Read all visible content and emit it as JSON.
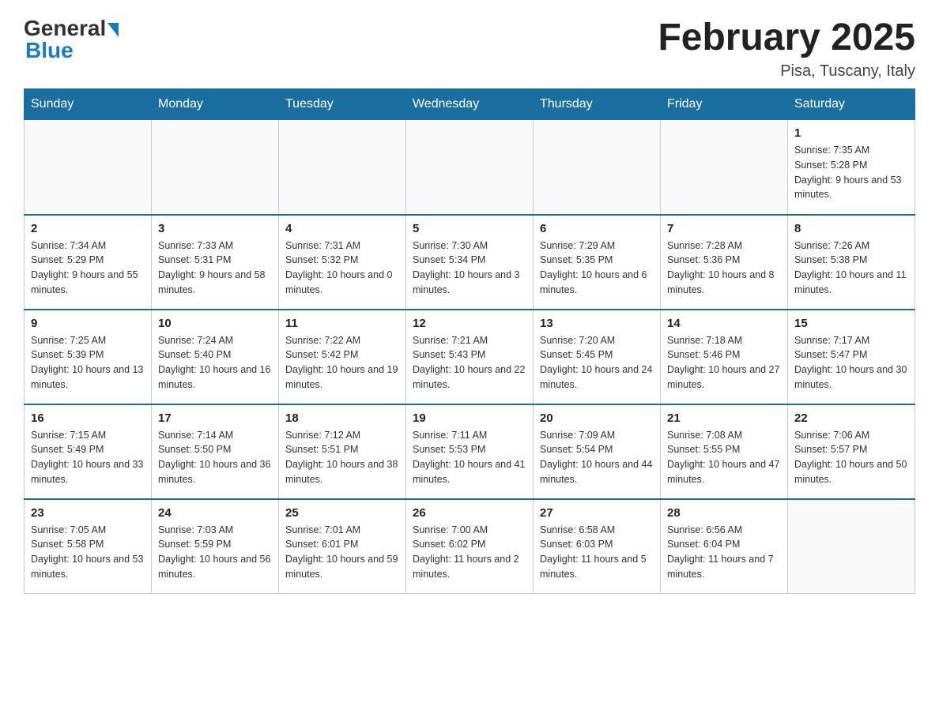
{
  "header": {
    "logo_general": "General",
    "logo_blue": "Blue",
    "month_title": "February 2025",
    "location": "Pisa, Tuscany, Italy"
  },
  "days_of_week": [
    "Sunday",
    "Monday",
    "Tuesday",
    "Wednesday",
    "Thursday",
    "Friday",
    "Saturday"
  ],
  "weeks": [
    {
      "days": [
        {
          "date": "",
          "info": ""
        },
        {
          "date": "",
          "info": ""
        },
        {
          "date": "",
          "info": ""
        },
        {
          "date": "",
          "info": ""
        },
        {
          "date": "",
          "info": ""
        },
        {
          "date": "",
          "info": ""
        },
        {
          "date": "1",
          "info": "Sunrise: 7:35 AM\nSunset: 5:28 PM\nDaylight: 9 hours and 53 minutes."
        }
      ]
    },
    {
      "days": [
        {
          "date": "2",
          "info": "Sunrise: 7:34 AM\nSunset: 5:29 PM\nDaylight: 9 hours and 55 minutes."
        },
        {
          "date": "3",
          "info": "Sunrise: 7:33 AM\nSunset: 5:31 PM\nDaylight: 9 hours and 58 minutes."
        },
        {
          "date": "4",
          "info": "Sunrise: 7:31 AM\nSunset: 5:32 PM\nDaylight: 10 hours and 0 minutes."
        },
        {
          "date": "5",
          "info": "Sunrise: 7:30 AM\nSunset: 5:34 PM\nDaylight: 10 hours and 3 minutes."
        },
        {
          "date": "6",
          "info": "Sunrise: 7:29 AM\nSunset: 5:35 PM\nDaylight: 10 hours and 6 minutes."
        },
        {
          "date": "7",
          "info": "Sunrise: 7:28 AM\nSunset: 5:36 PM\nDaylight: 10 hours and 8 minutes."
        },
        {
          "date": "8",
          "info": "Sunrise: 7:26 AM\nSunset: 5:38 PM\nDaylight: 10 hours and 11 minutes."
        }
      ]
    },
    {
      "days": [
        {
          "date": "9",
          "info": "Sunrise: 7:25 AM\nSunset: 5:39 PM\nDaylight: 10 hours and 13 minutes."
        },
        {
          "date": "10",
          "info": "Sunrise: 7:24 AM\nSunset: 5:40 PM\nDaylight: 10 hours and 16 minutes."
        },
        {
          "date": "11",
          "info": "Sunrise: 7:22 AM\nSunset: 5:42 PM\nDaylight: 10 hours and 19 minutes."
        },
        {
          "date": "12",
          "info": "Sunrise: 7:21 AM\nSunset: 5:43 PM\nDaylight: 10 hours and 22 minutes."
        },
        {
          "date": "13",
          "info": "Sunrise: 7:20 AM\nSunset: 5:45 PM\nDaylight: 10 hours and 24 minutes."
        },
        {
          "date": "14",
          "info": "Sunrise: 7:18 AM\nSunset: 5:46 PM\nDaylight: 10 hours and 27 minutes."
        },
        {
          "date": "15",
          "info": "Sunrise: 7:17 AM\nSunset: 5:47 PM\nDaylight: 10 hours and 30 minutes."
        }
      ]
    },
    {
      "days": [
        {
          "date": "16",
          "info": "Sunrise: 7:15 AM\nSunset: 5:49 PM\nDaylight: 10 hours and 33 minutes."
        },
        {
          "date": "17",
          "info": "Sunrise: 7:14 AM\nSunset: 5:50 PM\nDaylight: 10 hours and 36 minutes."
        },
        {
          "date": "18",
          "info": "Sunrise: 7:12 AM\nSunset: 5:51 PM\nDaylight: 10 hours and 38 minutes."
        },
        {
          "date": "19",
          "info": "Sunrise: 7:11 AM\nSunset: 5:53 PM\nDaylight: 10 hours and 41 minutes."
        },
        {
          "date": "20",
          "info": "Sunrise: 7:09 AM\nSunset: 5:54 PM\nDaylight: 10 hours and 44 minutes."
        },
        {
          "date": "21",
          "info": "Sunrise: 7:08 AM\nSunset: 5:55 PM\nDaylight: 10 hours and 47 minutes."
        },
        {
          "date": "22",
          "info": "Sunrise: 7:06 AM\nSunset: 5:57 PM\nDaylight: 10 hours and 50 minutes."
        }
      ]
    },
    {
      "days": [
        {
          "date": "23",
          "info": "Sunrise: 7:05 AM\nSunset: 5:58 PM\nDaylight: 10 hours and 53 minutes."
        },
        {
          "date": "24",
          "info": "Sunrise: 7:03 AM\nSunset: 5:59 PM\nDaylight: 10 hours and 56 minutes."
        },
        {
          "date": "25",
          "info": "Sunrise: 7:01 AM\nSunset: 6:01 PM\nDaylight: 10 hours and 59 minutes."
        },
        {
          "date": "26",
          "info": "Sunrise: 7:00 AM\nSunset: 6:02 PM\nDaylight: 11 hours and 2 minutes."
        },
        {
          "date": "27",
          "info": "Sunrise: 6:58 AM\nSunset: 6:03 PM\nDaylight: 11 hours and 5 minutes."
        },
        {
          "date": "28",
          "info": "Sunrise: 6:56 AM\nSunset: 6:04 PM\nDaylight: 11 hours and 7 minutes."
        },
        {
          "date": "",
          "info": ""
        }
      ]
    }
  ]
}
